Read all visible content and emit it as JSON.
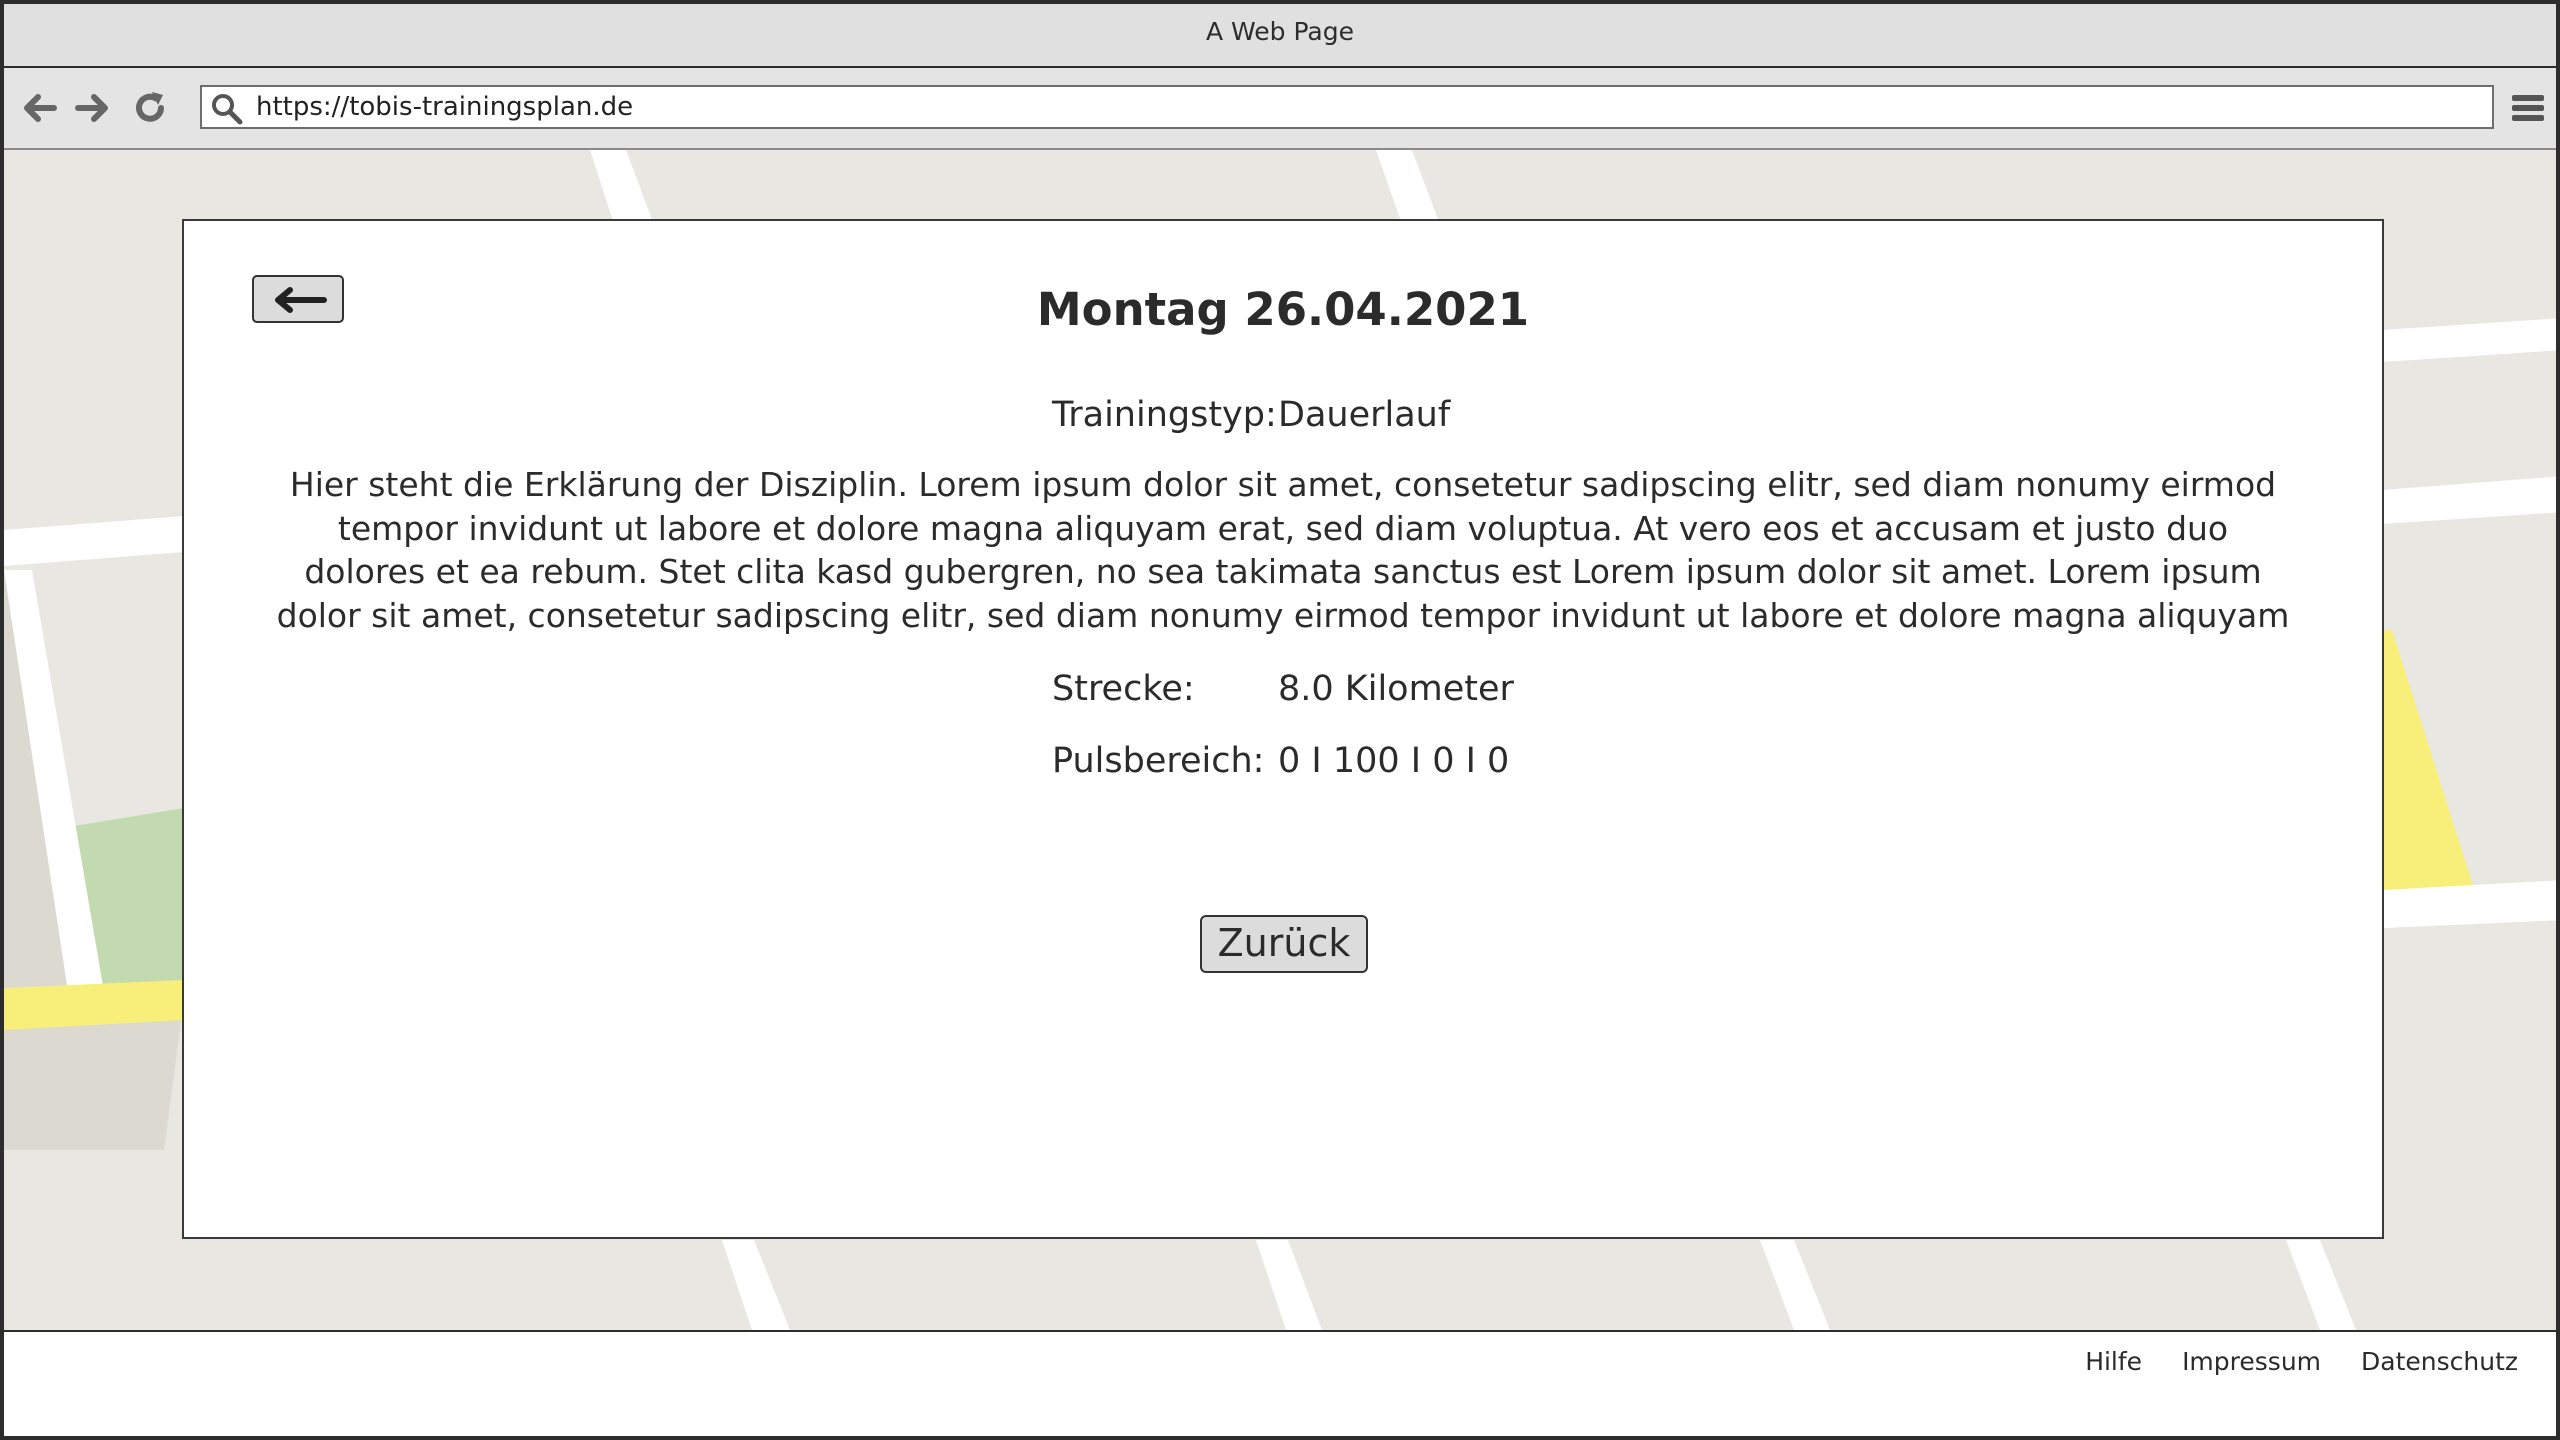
{
  "window": {
    "title": "A Web Page"
  },
  "toolbar": {
    "url": "https://tobis-trainingsplan.de",
    "icons": [
      "back-arrow-icon",
      "forward-arrow-icon",
      "reload-icon",
      "search-icon",
      "hamburger-menu-icon"
    ]
  },
  "dialog": {
    "title": "Montag 26.04.2021",
    "back_icon": "left-arrow-icon",
    "training_type_label": "Trainingstyp:",
    "training_type_value": "Dauerlauf",
    "description": "Hier steht die Erklärung der Disziplin. Lorem ipsum dolor sit amet, consetetur sadipscing elitr, sed diam nonumy eirmod tempor invidunt ut labore et dolore magna aliquyam erat, sed diam voluptua. At vero eos et accusam et justo duo dolores et ea rebum. Stet clita kasd gubergren, no sea takimata sanctus est Lorem ipsum dolor sit amet. Lorem ipsum dolor sit amet, consetetur sadipscing elitr, sed diam nonumy eirmod tempor invidunt ut labore et dolore magna aliquyam",
    "distance_label": "Strecke:",
    "distance_value": "8.0 Kilometer",
    "pulse_label": "Pulsbereich:",
    "pulse_value": "0 I 100 I 0 I 0",
    "back_button_label": "Zurück"
  },
  "footer": {
    "links": [
      "Hilfe",
      "Impressum",
      "Datenschutz"
    ]
  },
  "colors": {
    "map_background": "#e9e7e1",
    "map_road": "#ffffff",
    "map_highlight_road": "#f8ef7a",
    "map_park": "#c3d9b0",
    "button_fill": "#dcdcdc"
  }
}
